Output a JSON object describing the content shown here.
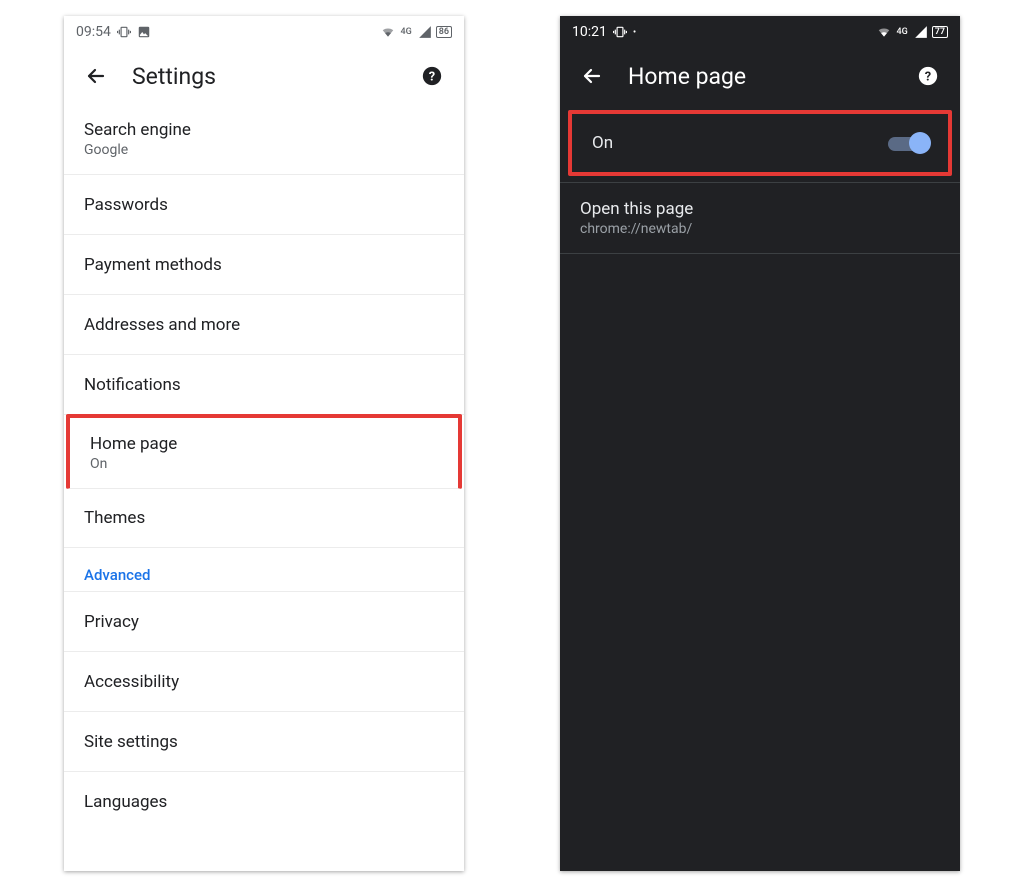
{
  "left": {
    "status": {
      "time": "09:54",
      "network_label": "4G",
      "battery": "86"
    },
    "appbar": {
      "title": "Settings"
    },
    "rows": {
      "search_engine": {
        "title": "Search engine",
        "sub": "Google"
      },
      "passwords": {
        "title": "Passwords"
      },
      "payment_methods": {
        "title": "Payment methods"
      },
      "addresses": {
        "title": "Addresses and more"
      },
      "notifications": {
        "title": "Notifications"
      },
      "home_page": {
        "title": "Home page",
        "sub": "On"
      },
      "themes": {
        "title": "Themes"
      },
      "advanced": {
        "title": "Advanced"
      },
      "privacy": {
        "title": "Privacy"
      },
      "accessibility": {
        "title": "Accessibility"
      },
      "site_settings": {
        "title": "Site settings"
      },
      "languages": {
        "title": "Languages"
      }
    }
  },
  "right": {
    "status": {
      "time": "10:21",
      "network_label": "4G",
      "battery": "77"
    },
    "appbar": {
      "title": "Home page"
    },
    "toggle": {
      "label": "On",
      "state": "on"
    },
    "open_page": {
      "title": "Open this page",
      "sub": "chrome://newtab/"
    }
  }
}
